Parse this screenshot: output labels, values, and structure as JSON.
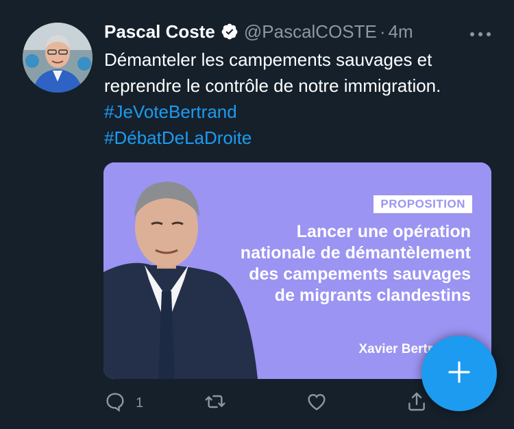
{
  "tweet": {
    "author_name": "Pascal Coste",
    "handle": "@PascalCOSTE",
    "separator": "·",
    "time": "4m",
    "text_plain": "Démanteler les campements sauvages et reprendre le contrôle de notre immigration.",
    "hashtags": [
      "#JeVoteBertrand",
      "#DébatDeLaDroite"
    ],
    "card": {
      "label": "PROPOSITION",
      "quote": "Lancer une opération nationale de démantèlement des campements sauvages de migrants clandestins",
      "author": "Xavier Bertrand"
    },
    "actions": {
      "reply_count": "1"
    }
  },
  "colors": {
    "background": "#15202b",
    "accent": "#1d9bf0",
    "secondary_text": "#8b98a5",
    "card_background": "#9b94f2"
  },
  "icons": {
    "verified": "verified-badge-icon",
    "more": "more-horizontal-icon",
    "reply": "reply-icon",
    "retweet": "retweet-icon",
    "like": "heart-icon",
    "share": "share-icon",
    "compose": "plus-icon"
  }
}
